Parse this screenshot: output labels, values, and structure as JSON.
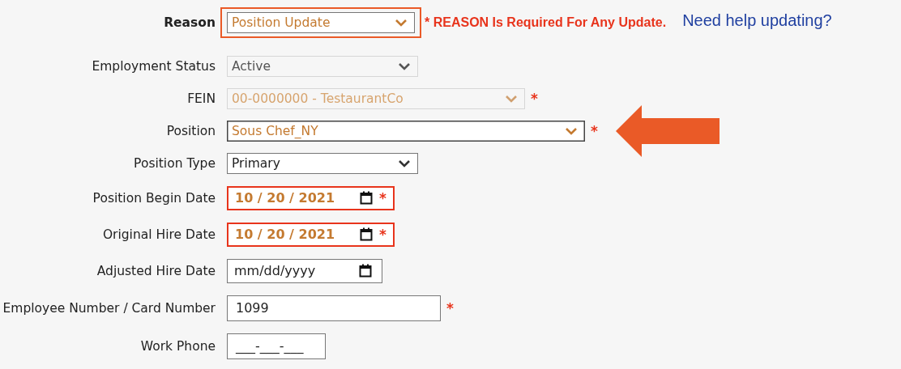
{
  "reason": {
    "label": "Reason",
    "value": "Position Update",
    "highlighted": true,
    "modified": true,
    "note": "* REASON Is Required For Any Update.",
    "help_link": "Need help updating?"
  },
  "fields": [
    {
      "kind": "select",
      "label": "Employment Status",
      "value": "Active",
      "disabled": true,
      "invalid": false,
      "modified": false,
      "pointer": false
    },
    {
      "kind": "select",
      "label": "FEIN",
      "value": "00-0000000 - TestaurantCo",
      "disabled": true,
      "invalid": false,
      "modified": true,
      "pointer": false,
      "required_mark": "*"
    },
    {
      "kind": "select",
      "label": "Position",
      "value": "Sous Chef_NY",
      "disabled": false,
      "invalid": false,
      "modified": true,
      "pointer": true,
      "required_mark": "*"
    },
    {
      "kind": "select",
      "label": "Position Type",
      "value": "Primary",
      "disabled": false,
      "invalid": false,
      "modified": false,
      "pointer": false
    },
    {
      "kind": "date",
      "label": "Position Begin Date",
      "value": "10 / 20 / 2021",
      "disabled": false,
      "invalid": true,
      "modified": true,
      "pointer": false,
      "required_mark": "*"
    },
    {
      "kind": "date",
      "label": "Original Hire Date",
      "value": "10 / 20 / 2021",
      "disabled": false,
      "invalid": true,
      "modified": true,
      "pointer": false,
      "required_mark": "*"
    },
    {
      "kind": "date",
      "label": "Adjusted Hire Date",
      "value": "mm/dd/yyyy",
      "disabled": false,
      "invalid": false,
      "modified": false,
      "pointer": false
    },
    {
      "kind": "text",
      "label": "Employee Number / Card Number",
      "value": "1099",
      "disabled": false,
      "invalid": false,
      "modified": false,
      "pointer": false,
      "required_mark": "*"
    },
    {
      "kind": "text",
      "label": "Work Phone",
      "value": "___-___-___",
      "disabled": false,
      "invalid": false,
      "modified": false,
      "pointer": false
    }
  ]
}
